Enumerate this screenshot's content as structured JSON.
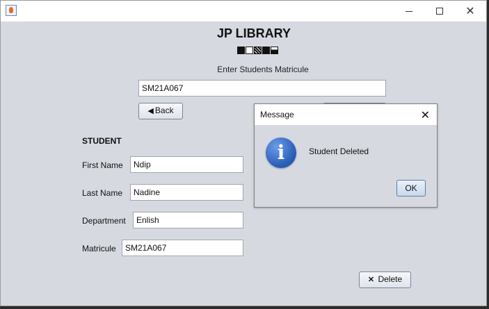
{
  "window": {
    "app_icon": "java-icon",
    "controls": {
      "minimize": "minimize-icon",
      "maximize": "maximize-icon",
      "close": "close-icon"
    }
  },
  "header": {
    "title": "JP LIBRARY",
    "decorative_icons": [
      "book-icon",
      "book-icon",
      "book-icon",
      "book-icon",
      "book-icon"
    ]
  },
  "search": {
    "prompt": "Enter Students Matricule",
    "value": "SM21A067"
  },
  "buttons": {
    "back_label": "Back",
    "back_icon": "left-arrow-icon",
    "delete_label": "Delete",
    "delete_icon": "x-icon"
  },
  "student": {
    "section_title": "STUDENT",
    "fields": [
      {
        "label": "First Name",
        "value": "Ndip"
      },
      {
        "label": "Last Name",
        "value": "Nadine"
      },
      {
        "label": "Department",
        "value": "Enlish"
      },
      {
        "label": "Matricule",
        "value": "SM21A067"
      }
    ]
  },
  "dialog": {
    "title": "Message",
    "message": "Student Deleted",
    "ok_label": "OK",
    "icon": "info-icon"
  }
}
